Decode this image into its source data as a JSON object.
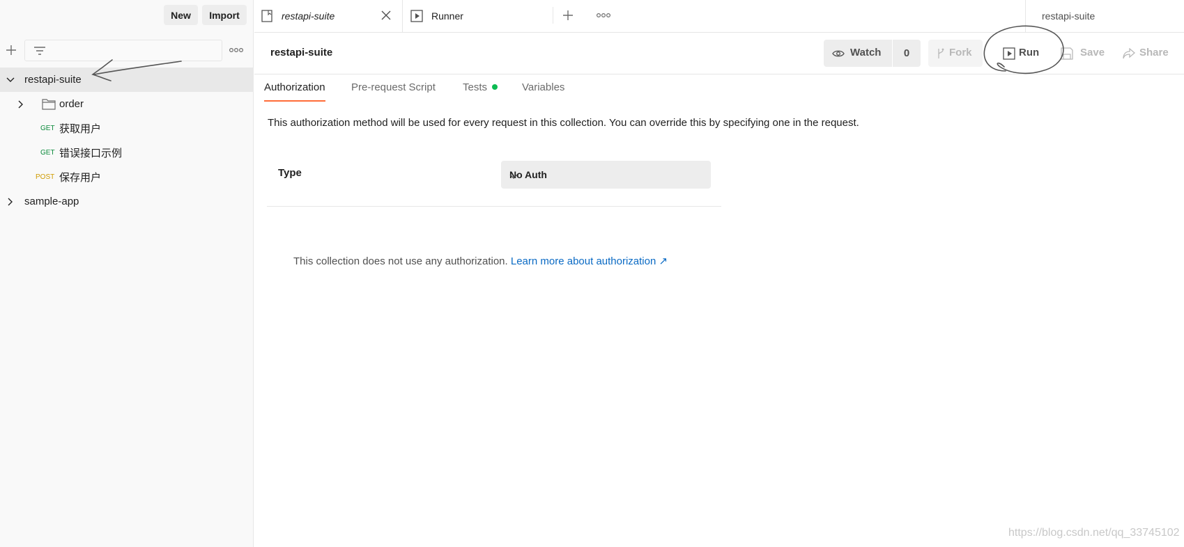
{
  "sidebar": {
    "new_label": "New",
    "import_label": "Import",
    "filter_placeholder": "",
    "tree": [
      {
        "label": "restapi-suite",
        "type": "collection",
        "expanded": true,
        "selected": true
      },
      {
        "label": "order",
        "type": "folder",
        "expanded": false
      },
      {
        "method": "GET",
        "label": "获取用户",
        "type": "request"
      },
      {
        "method": "GET",
        "label": "错误接口示例",
        "type": "request"
      },
      {
        "method": "POST",
        "label": "保存用户",
        "type": "request"
      },
      {
        "label": "sample-app",
        "type": "collection",
        "expanded": false
      }
    ]
  },
  "tabs": {
    "items": [
      {
        "label": "restapi-suite",
        "icon": "collection-icon",
        "active": true
      },
      {
        "label": "Runner",
        "icon": "runner-icon",
        "active": false
      }
    ],
    "environment": "restapi-suite"
  },
  "header": {
    "title": "restapi-suite",
    "watch_label": "Watch",
    "watch_count": "0",
    "fork_label": "Fork",
    "run_label": "Run",
    "save_label": "Save",
    "share_label": "Share"
  },
  "subtabs": {
    "authorization": "Authorization",
    "prerequest": "Pre-request Script",
    "tests": "Tests",
    "variables": "Variables"
  },
  "auth": {
    "description": "This authorization method will be used for every request in this collection. You can override this by specifying one in the request.",
    "type_label": "Type",
    "type_value": "No Auth",
    "note": "This collection does not use any authorization.",
    "learn_more": "Learn more about authorization ↗"
  },
  "watermark": "https://blog.csdn.net/qq_33745102",
  "colors": {
    "accent": "#ff6c37",
    "get": "#0a8a3a",
    "post": "#cf9b00",
    "link": "#0a6ac4",
    "tests_dot": "#0cbb52"
  }
}
